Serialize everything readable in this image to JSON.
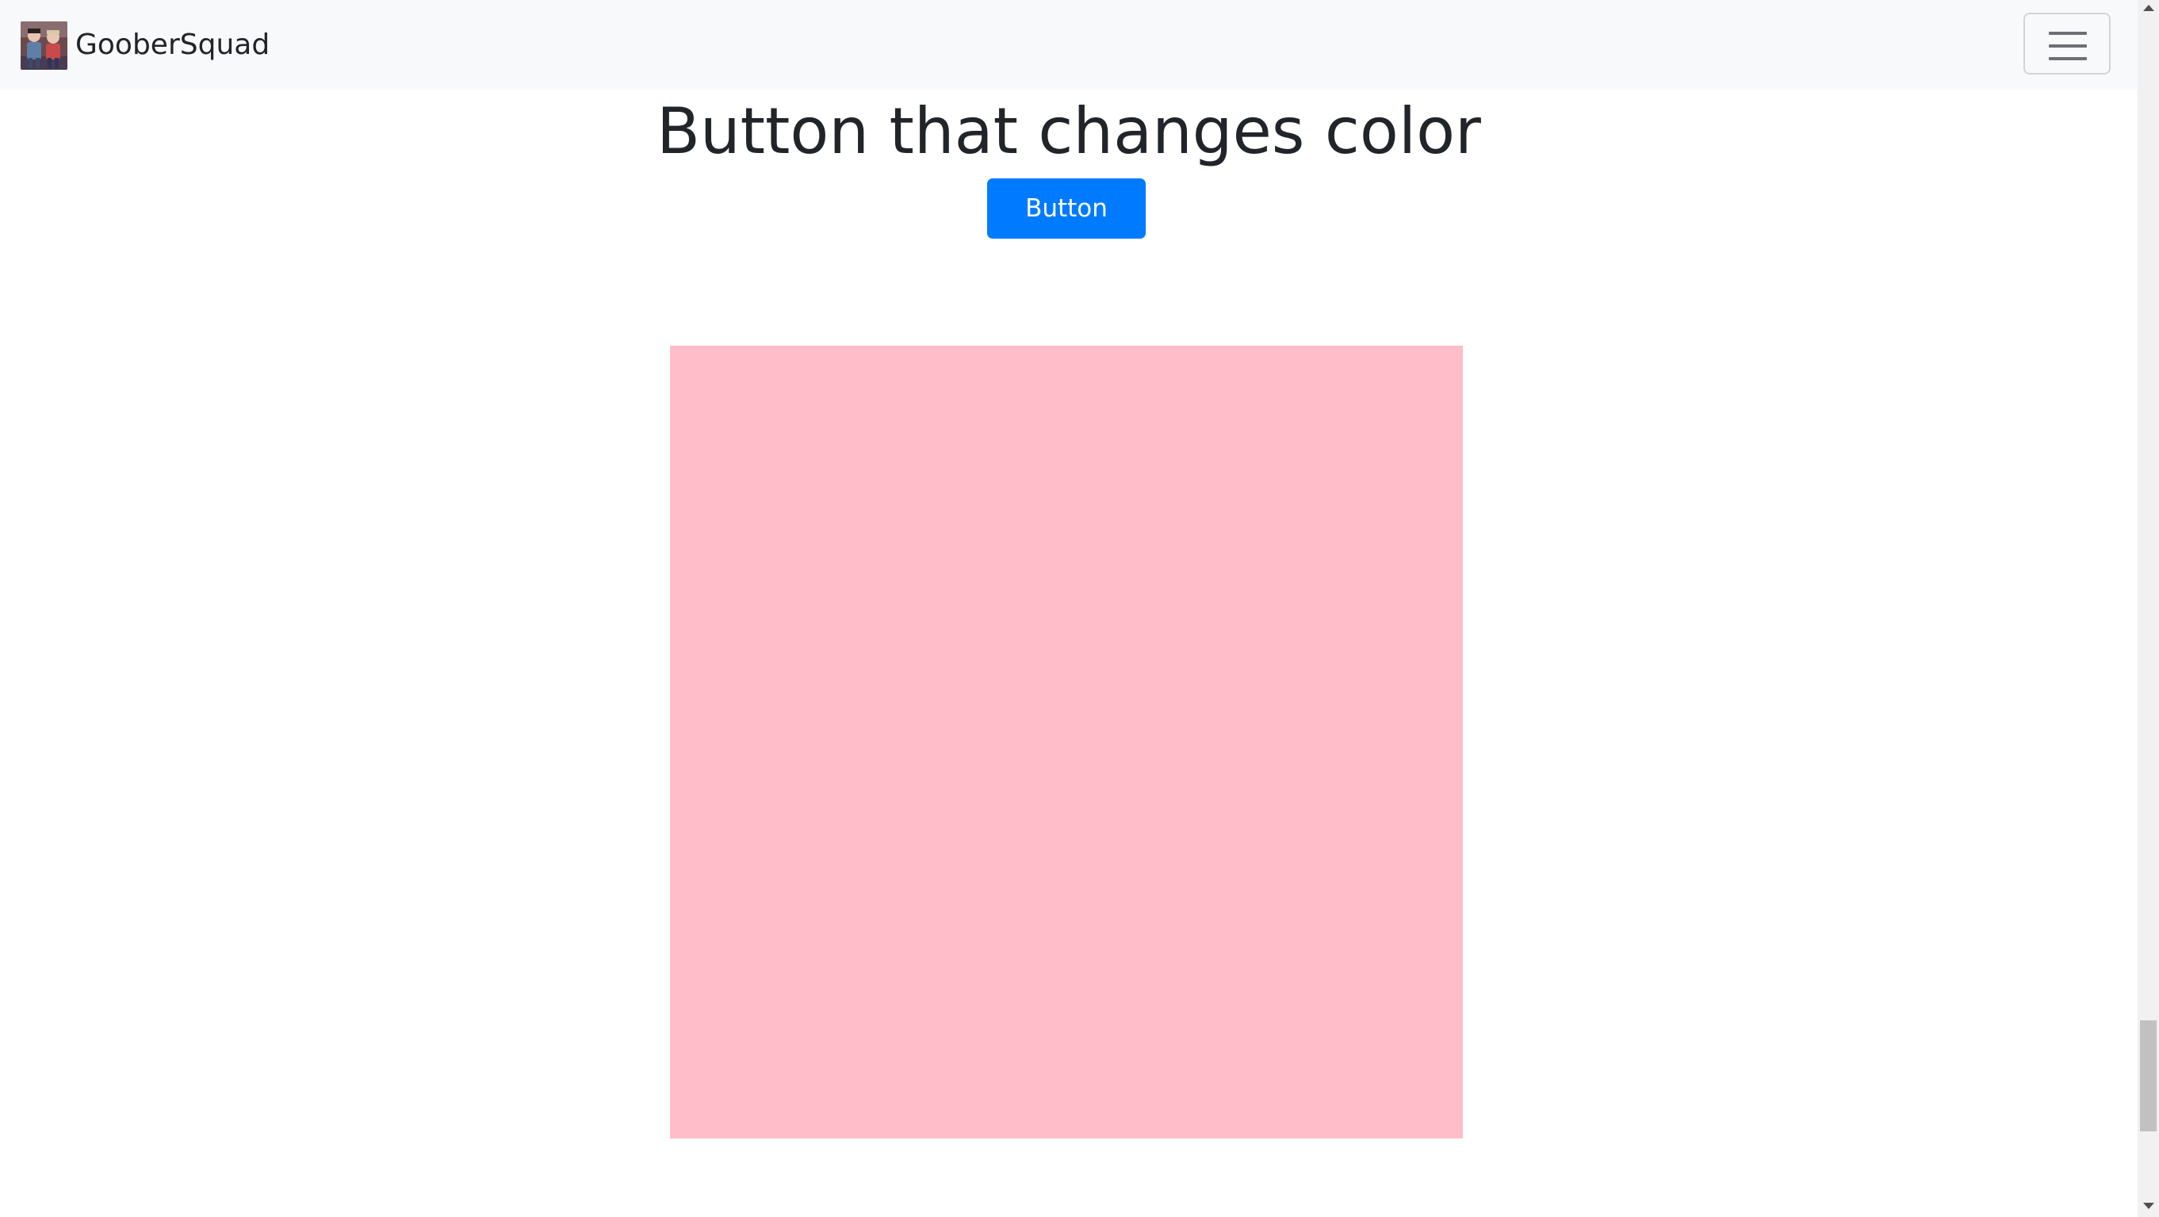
{
  "navbar": {
    "brand_text": "GooberSquad",
    "logo_icon": "goober-squad-photo-logo",
    "toggler_icon": "hamburger-menu-icon"
  },
  "main": {
    "title": "Button that changes color",
    "button_label": "Button",
    "button_color": "#007bff",
    "box_color": "#ffbcc9"
  },
  "colors": {
    "navbar_background": "#f8f9fa",
    "text": "#212529"
  }
}
